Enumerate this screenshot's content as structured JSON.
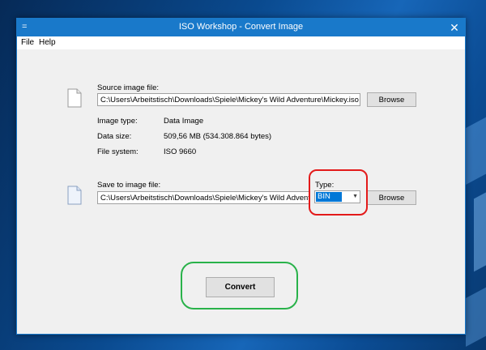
{
  "window": {
    "title": "ISO Workshop - Convert Image",
    "app_icon": "=",
    "close_glyph": "✕"
  },
  "menu": [
    "File",
    "Help"
  ],
  "source": {
    "label": "Source image file:",
    "path": "C:\\Users\\Arbeitstisch\\Downloads\\Spiele\\Mickey's Wild Adventure\\Mickey.iso",
    "browse_label": "Browse"
  },
  "info": [
    {
      "label": "Image type:",
      "value": "Data Image"
    },
    {
      "label": "Data size:",
      "value": "509,56 MB (534.308.864 bytes)"
    },
    {
      "label": "File system:",
      "value": "ISO 9660"
    }
  ],
  "target": {
    "label": "Save to image file:",
    "path": "C:\\Users\\Arbeitstisch\\Downloads\\Spiele\\Mickey's Wild Adventure\\Mickey.bin",
    "type_label": "Type:",
    "type_value": "BIN",
    "browse_label": "Browse"
  },
  "convert_label": "Convert",
  "colors": {
    "titlebar": "#1979ca",
    "highlight_red": "#e31a1a",
    "highlight_green": "#29b24a",
    "selection": "#0078d7"
  },
  "icons": {
    "source_file": "file-icon",
    "target_file": "file-icon",
    "dropdown": "chevron-down-icon"
  }
}
